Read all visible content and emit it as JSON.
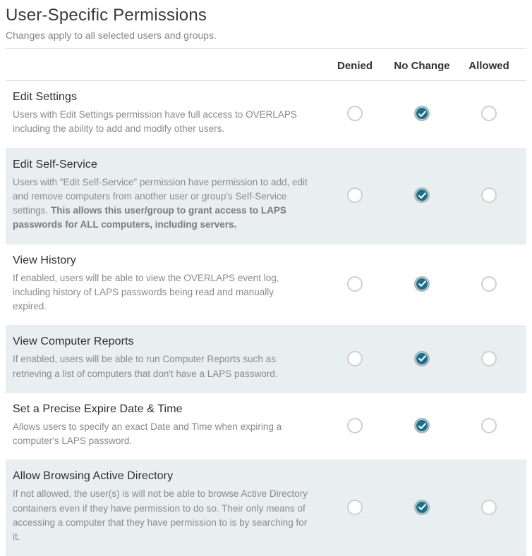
{
  "header": {
    "title": "User-Specific Permissions",
    "subtitle": "Changes apply to all selected users and groups."
  },
  "columns": {
    "denied": "Denied",
    "no_change": "No Change",
    "allowed": "Allowed"
  },
  "permissions": [
    {
      "id": "edit-settings",
      "title": "Edit Settings",
      "desc": "Users with Edit Settings permission have full access to OVERLAPS including the ability to add and modify other users.",
      "selected": "no_change",
      "alt": false
    },
    {
      "id": "edit-self-service",
      "title": "Edit Self-Service",
      "desc_pre": "Users with \"Edit Self-Service\" permission have permission to add, edit and remove computers from another user or group's Self-Service settings. ",
      "desc_bold": "This allows this user/group to grant access to LAPS passwords for ALL computers, including servers.",
      "selected": "no_change",
      "alt": true
    },
    {
      "id": "view-history",
      "title": "View History",
      "desc": "If enabled, users will be able to view the OVERLAPS event log, including history of LAPS passwords being read and manually expired.",
      "selected": "no_change",
      "alt": false
    },
    {
      "id": "view-computer-reports",
      "title": "View Computer Reports",
      "desc": "If enabled, users will be able to run Computer Reports such as retrieving a list of computers that don't have a LAPS password.",
      "selected": "no_change",
      "alt": true
    },
    {
      "id": "set-precise-expire",
      "title": "Set a Precise Expire Date & Time",
      "desc": "Allows users to specify an exact Date and Time when expiring a computer's LAPS password.",
      "selected": "no_change",
      "alt": false
    },
    {
      "id": "allow-browsing-ad",
      "title": "Allow Browsing Active Directory",
      "desc": "If not allowed, the user(s) is will not be able to browse Active Directory containers even if they have permission to do so. Their only means of accessing a computer that they have permission to is by searching for it.",
      "selected": "no_change",
      "alt": true
    }
  ]
}
